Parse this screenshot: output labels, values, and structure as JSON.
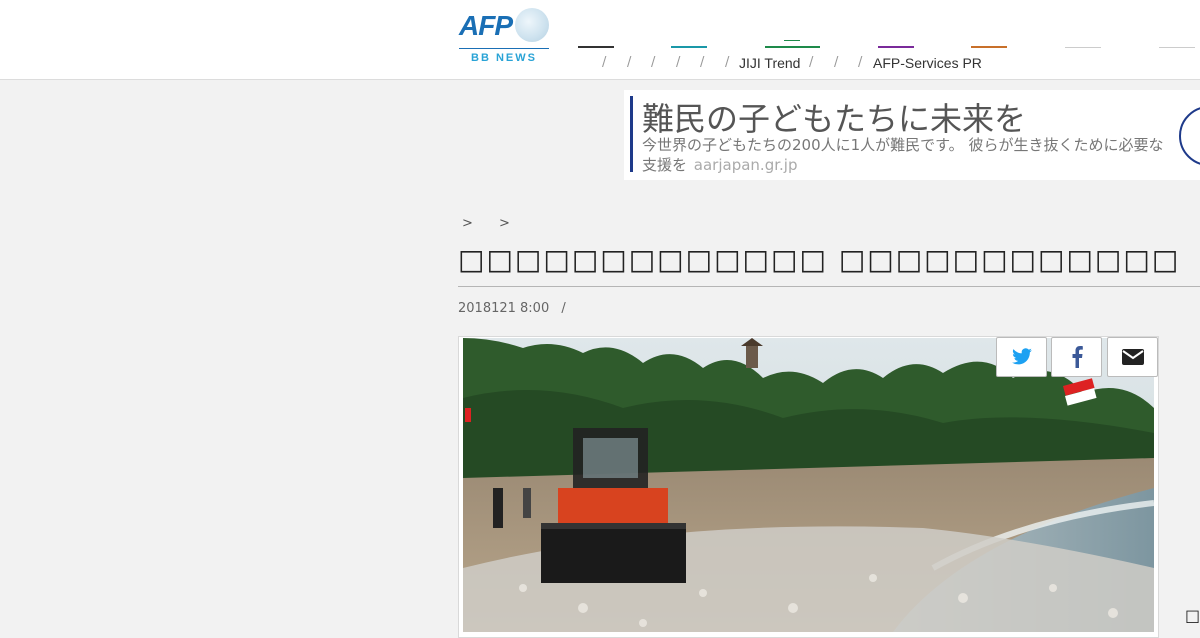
{
  "header": {
    "logo_main": "AFP",
    "logo_sub": "BB NEWS",
    "nav_items": [
      "JIJI Trend",
      "AFP-Services PR"
    ],
    "nav_separator": "/",
    "nav_colors": [
      "#333333",
      "#1a98a8",
      "#1e8a4a",
      "#7a2a9a",
      "#c8702a",
      "#cccccc",
      "#cccccc"
    ]
  },
  "ad": {
    "title": "難民の子どもたちに未来を",
    "description": "今世界の子どもたちの200人に1人が難民です。 彼らが生き抜くために必要な支援を",
    "url": "aarjapan.gr.jp"
  },
  "article": {
    "breadcrumb": [
      ">",
      ">"
    ],
    "title": "□□□□□□□□□□□□□ □□□□□□□□□□□□",
    "date": "2018121 8:00",
    "meta_separator": "/"
  },
  "share": {
    "twitter_label": "twitter-icon",
    "facebook_label": "facebook-icon",
    "email_label": "email-icon"
  },
  "corner_glyph": "□□"
}
